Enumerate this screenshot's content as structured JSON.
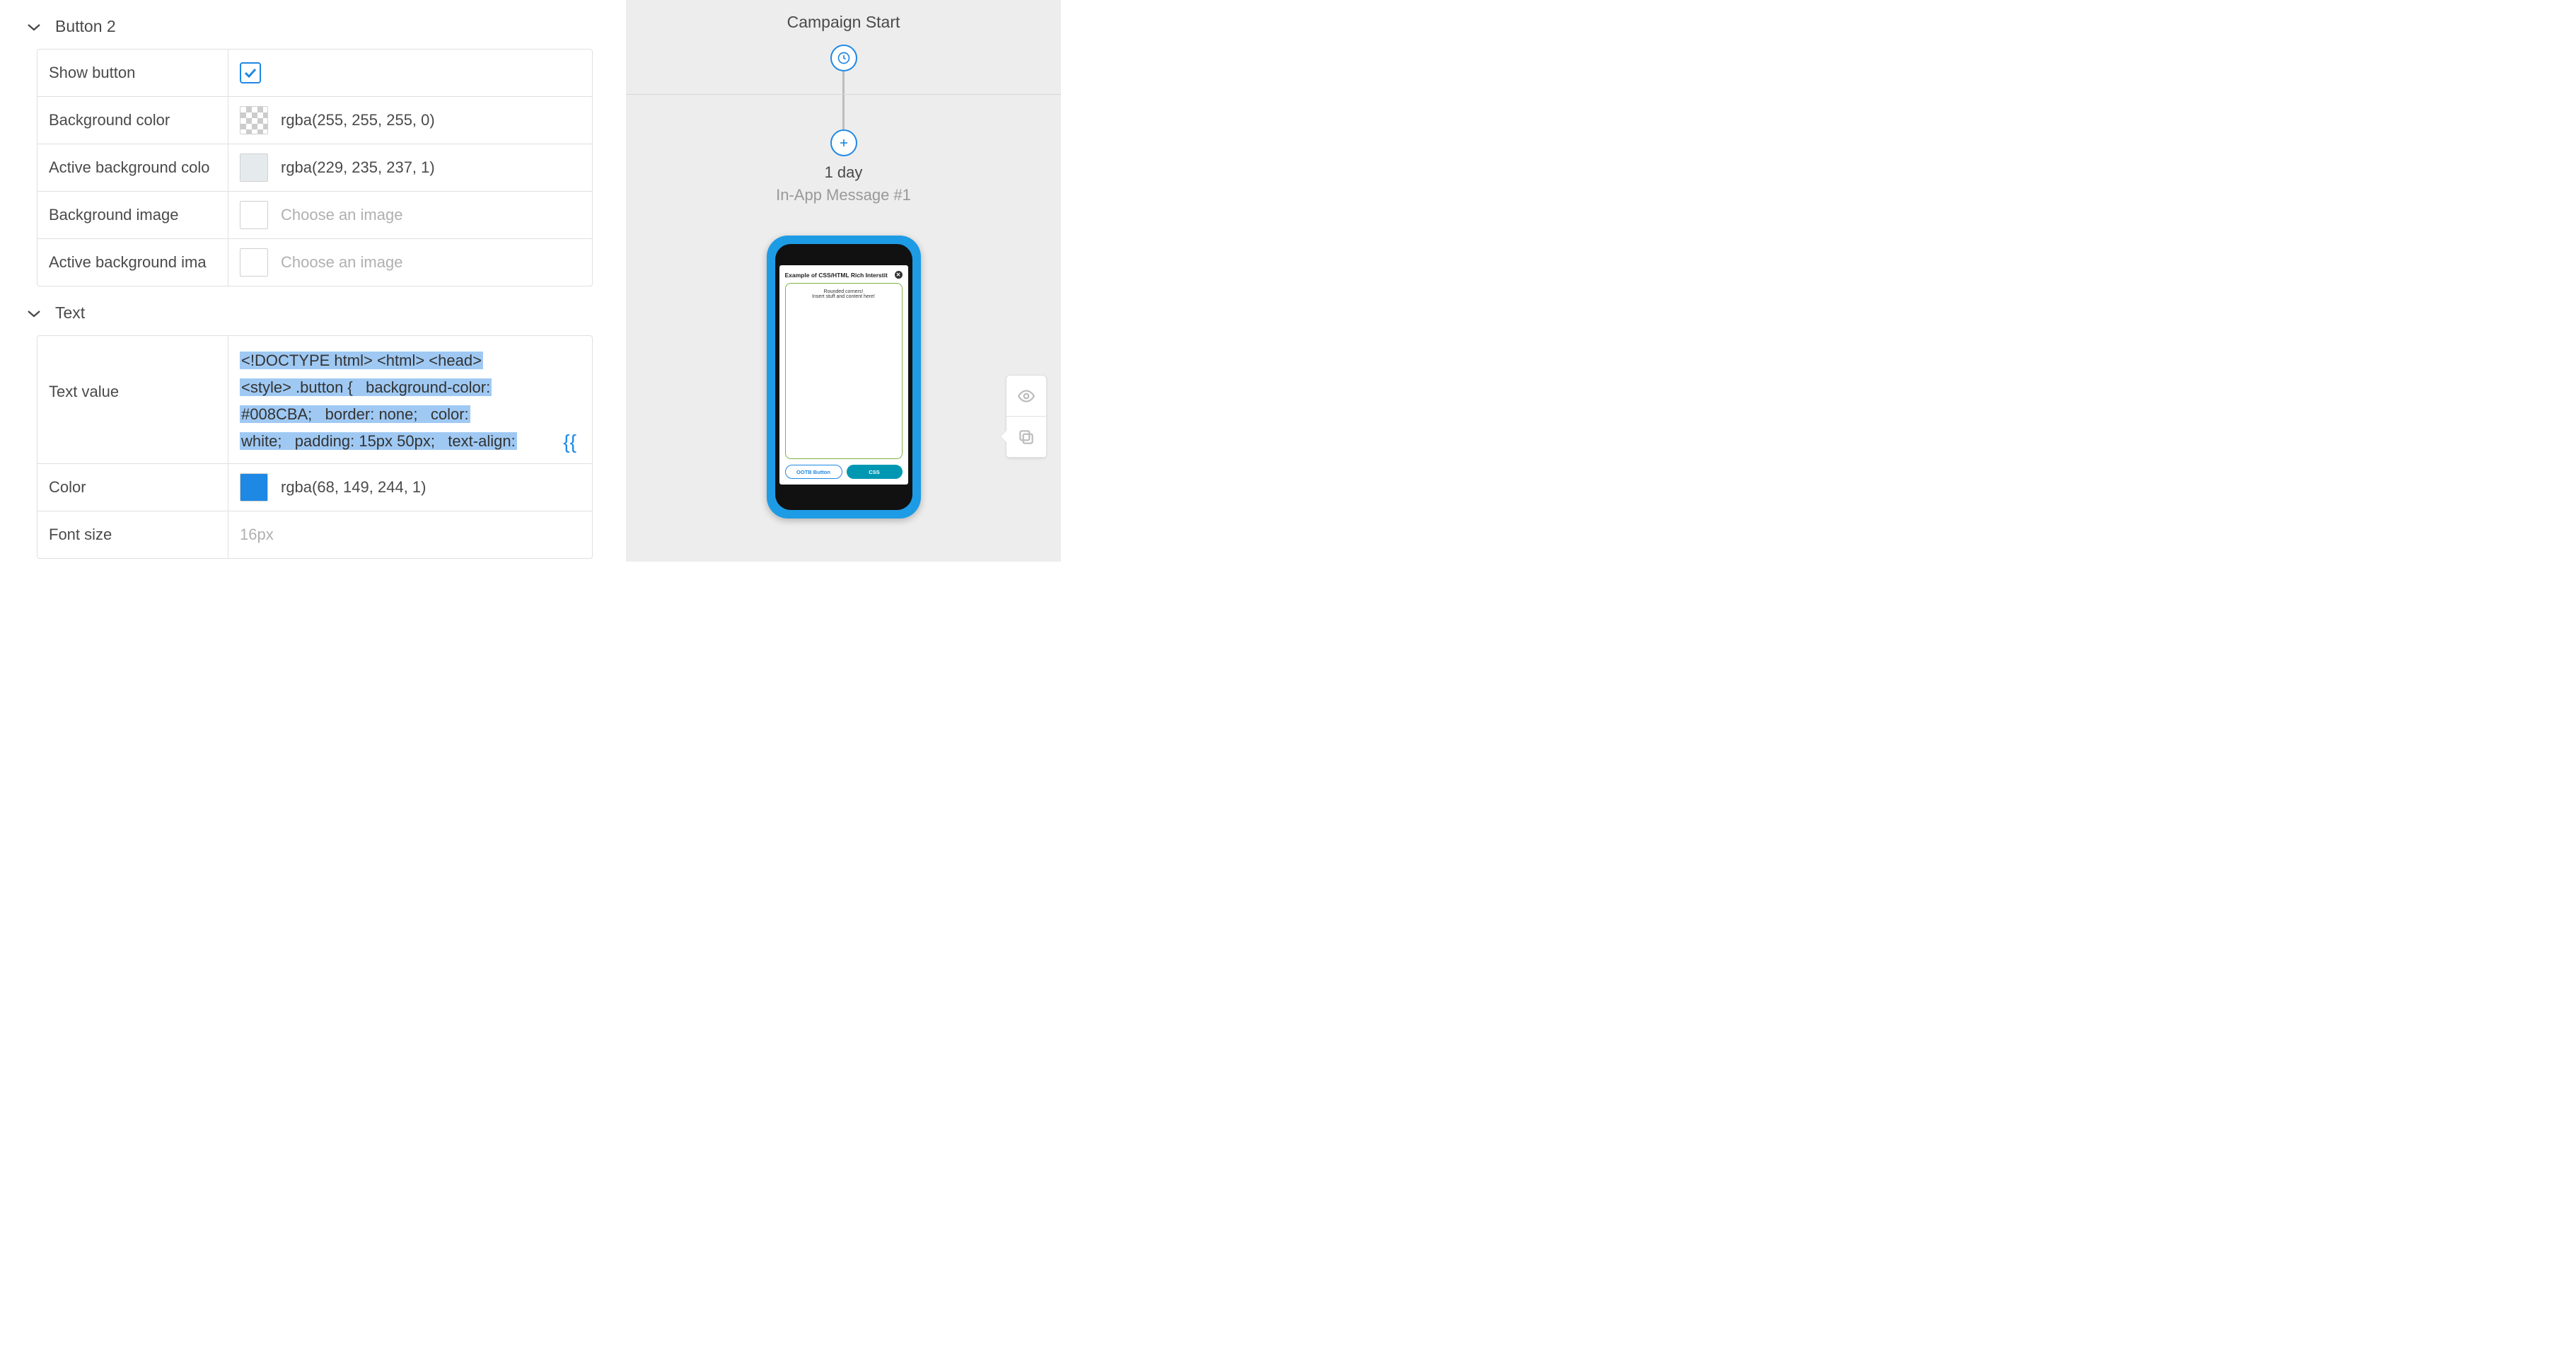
{
  "sections": {
    "button2": {
      "title": "Button 2",
      "rows": {
        "show_button": {
          "label": "Show button",
          "checked": true
        },
        "bg_color": {
          "label": "Background color",
          "value": "rgba(255, 255, 255, 0)",
          "swatch": "transparent"
        },
        "active_bg_color": {
          "label": "Active background color",
          "value": "rgba(229, 235, 237, 1)",
          "swatch": "#e5ebed"
        },
        "bg_image": {
          "label": "Background image",
          "placeholder": "Choose an image"
        },
        "active_bg_image": {
          "label": "Active background image",
          "placeholder": "Choose an image"
        }
      }
    },
    "text": {
      "title": "Text",
      "rows": {
        "text_value": {
          "label": "Text value",
          "value": "<!DOCTYPE html> <html> <head> <style> .button {   background-color: #008CBA;   border: none;   color: white;   padding: 15px 50px;   text-align:",
          "merge_token": "{{"
        },
        "color": {
          "label": "Color",
          "value": "rgba(68, 149, 244, 1)",
          "swatch": "#4495f4"
        },
        "font_size": {
          "label": "Font size",
          "value": "16px"
        }
      }
    }
  },
  "right": {
    "title": "Campaign Start",
    "delay_label": "1 day",
    "node_label": "In-App Message #1"
  },
  "phone": {
    "screen_title": "Example of CSS/HTML Rich Interstit",
    "content_line1": "Rounded corners!",
    "content_line2": "Insert stuff and content here!",
    "btn1": "OOTB Button",
    "btn2": "CSS"
  }
}
